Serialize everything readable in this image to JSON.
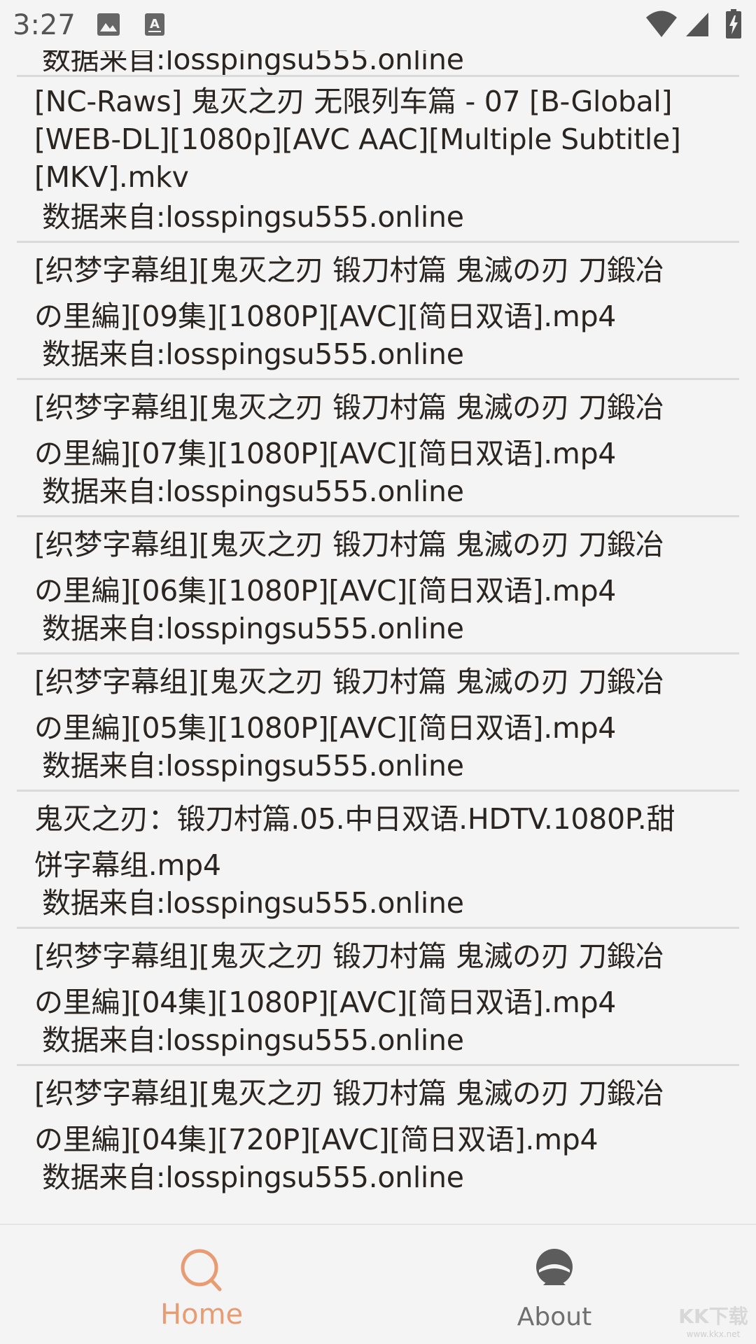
{
  "status_bar": {
    "time": "3:27",
    "left_icons": [
      "image-icon",
      "text-a-icon"
    ],
    "right_icons": [
      "wifi-icon",
      "signal-icon",
      "battery-charging-icon"
    ]
  },
  "results": [
    {
      "title": "[NC-Raws] 鬼灭之刃 无限列车篇 - 07 [B-Global]\n[WEB-DL][1080p][AVC AAC][Multiple Subtitle]\n[MKV].mkv",
      "source": "数据来自:losspingsu555.online"
    },
    {
      "title": "[织梦字幕组][鬼灭之刃 锻刀村篇 鬼滅の刃 刀鍛冶\nの里編][09集][1080P][AVC][简日双语].mp4",
      "source": "数据来自:losspingsu555.online"
    },
    {
      "title": "[织梦字幕组][鬼灭之刃 锻刀村篇 鬼滅の刃 刀鍛冶\nの里編][07集][1080P][AVC][简日双语].mp4",
      "source": "数据来自:losspingsu555.online"
    },
    {
      "title": "[织梦字幕组][鬼灭之刃 锻刀村篇 鬼滅の刃 刀鍛冶\nの里編][06集][1080P][AVC][简日双语].mp4",
      "source": "数据来自:losspingsu555.online"
    },
    {
      "title": "[织梦字幕组][鬼灭之刃 锻刀村篇 鬼滅の刃 刀鍛冶\nの里編][05集][1080P][AVC][简日双语].mp4",
      "source": "数据来自:losspingsu555.online"
    },
    {
      "title": "鬼灭之刃：锻刀村篇.05.中日双语.HDTV.1080P.甜\n饼字幕组.mp4",
      "source": "数据来自:losspingsu555.online"
    },
    {
      "title": "[织梦字幕组][鬼灭之刃 锻刀村篇 鬼滅の刃 刀鍛冶\nの里編][04集][1080P][AVC][简日双语].mp4",
      "source": "数据来自:losspingsu555.online"
    },
    {
      "title": "[织梦字幕组][鬼灭之刃 锻刀村篇 鬼滅の刃 刀鍛冶\nの里編][04集][720P][AVC][简日双语].mp4",
      "source": "数据来自:losspingsu555.online"
    }
  ],
  "bottom_nav": {
    "home": {
      "label": "Home",
      "icon": "search-icon",
      "active": true
    },
    "about": {
      "label": "About",
      "icon": "person-icon",
      "active": false
    }
  },
  "colors": {
    "accent": "#e89c73",
    "divider": "#dadada",
    "background": "#f4f4f4"
  }
}
